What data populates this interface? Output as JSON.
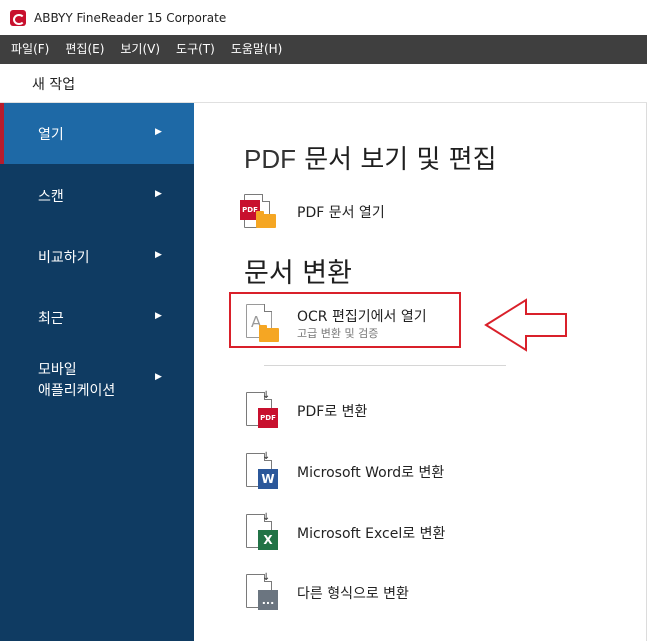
{
  "app": {
    "title": "ABBYY FineReader 15 Corporate"
  },
  "menu": [
    "파일(F)",
    "편집(E)",
    "보기(V)",
    "도구(T)",
    "도움말(H)"
  ],
  "task": {
    "label": "새 작업"
  },
  "sidebar": {
    "items": [
      {
        "label": "열기",
        "active": true
      },
      {
        "label": "스캔"
      },
      {
        "label": "비교하기"
      },
      {
        "label": "최근"
      },
      {
        "label_line1": "모바일",
        "label_line2": "애플리케이션"
      }
    ]
  },
  "main": {
    "pdf_section": {
      "title_prefix": "PDF",
      "title_rest": "문서 보기 및 편집",
      "open_pdf": "PDF 문서 열기"
    },
    "convert_section": {
      "title": "문서 변환",
      "ocr_title": "OCR 편집기에서 열기",
      "ocr_subtitle": "고급 변환 및 검증",
      "to_pdf": "PDF로 변환",
      "to_word": "Microsoft Word로 변환",
      "to_excel": "Microsoft Excel로 변환",
      "to_other": "다른 형식으로 변환"
    },
    "badges": {
      "pdf": "PDF",
      "word": "W",
      "excel": "X",
      "other": "...",
      "ocr": "A"
    }
  },
  "colors": {
    "sidebar": "#0f3b62",
    "sidebar_active": "#1e69a6",
    "menubar": "#3f3f3f",
    "highlight": "#d9202a",
    "folder": "#f5a623"
  }
}
